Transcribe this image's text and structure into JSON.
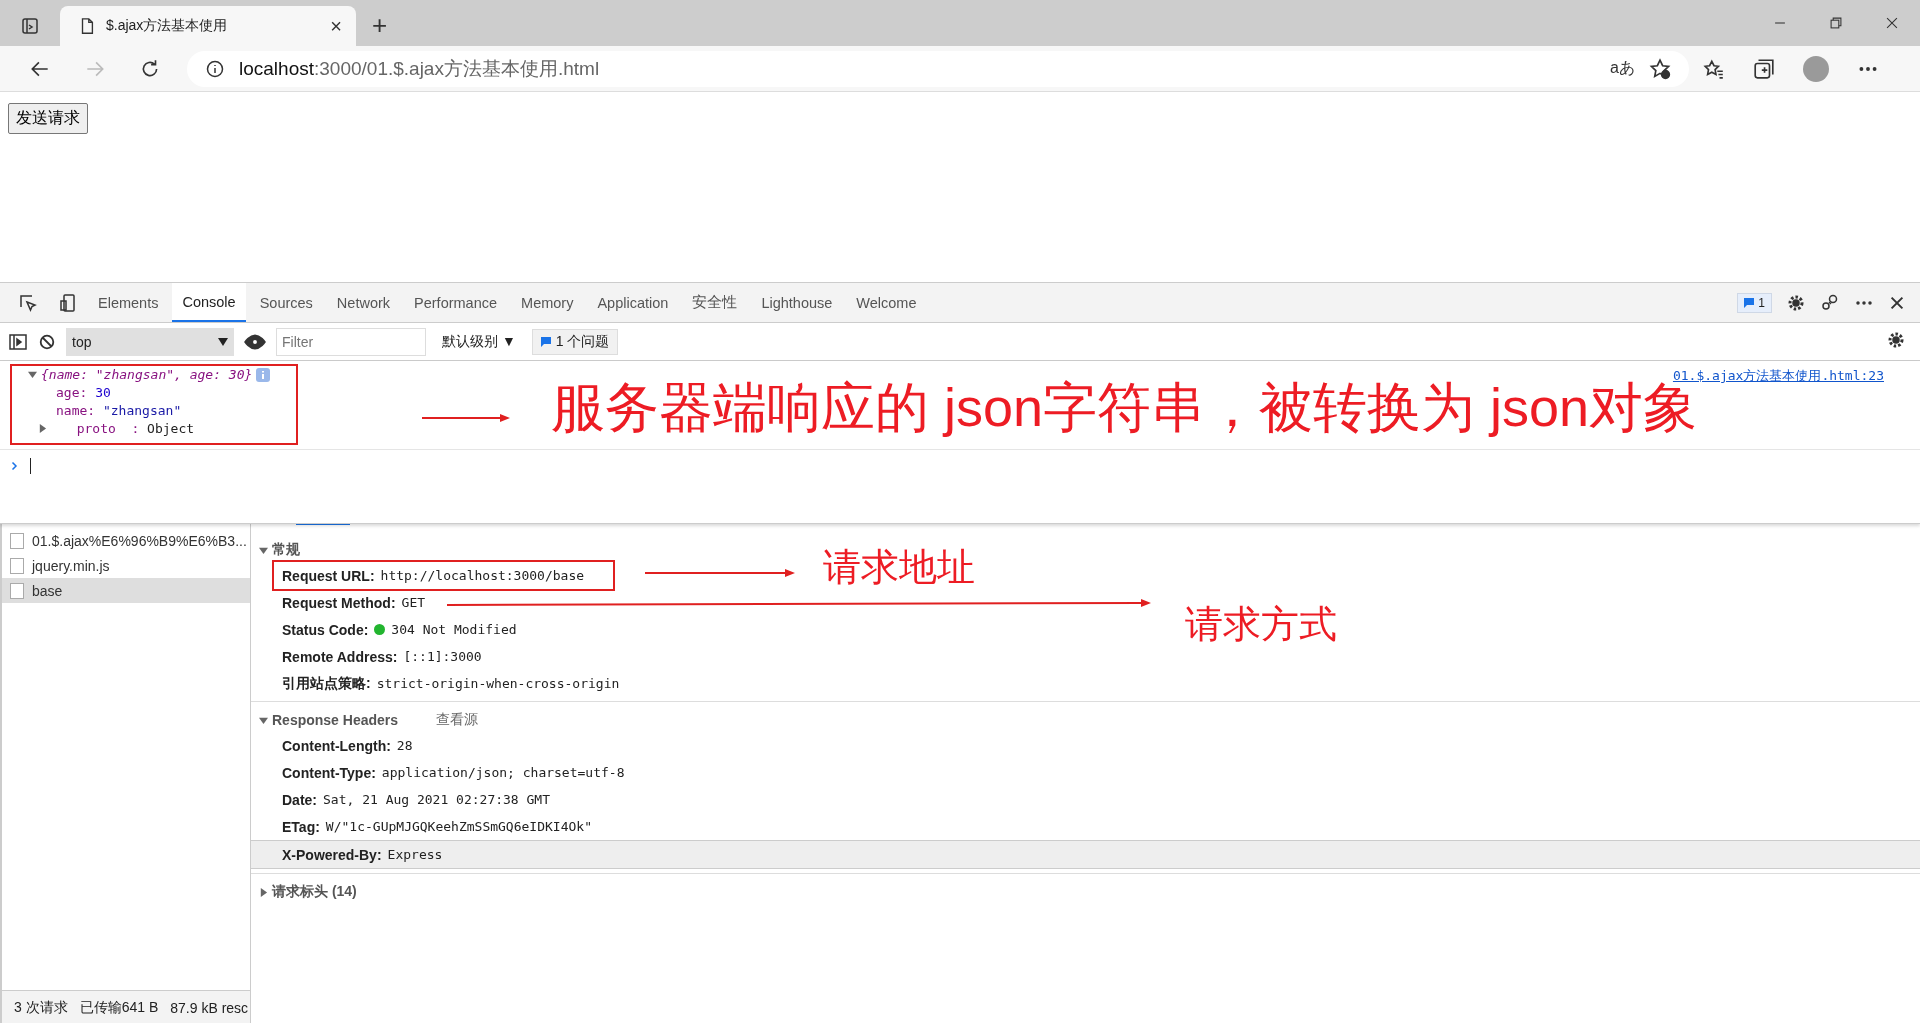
{
  "browser": {
    "tab": {
      "title": "$.ajax方法基本使用",
      "close": "×"
    },
    "new_tab": "+",
    "address": {
      "host": "localhost",
      "path": ":3000/01.$.ajax方法基本使用.html"
    },
    "read_aloud": "aあ"
  },
  "page": {
    "button": "发送请求"
  },
  "devtools": {
    "tabs": [
      {
        "label": "Elements",
        "selected": false
      },
      {
        "label": "Console",
        "selected": true
      },
      {
        "label": "Sources",
        "selected": false
      },
      {
        "label": "Network",
        "selected": false
      },
      {
        "label": "Performance",
        "selected": false
      },
      {
        "label": "Memory",
        "selected": false
      },
      {
        "label": "Application",
        "selected": false
      },
      {
        "label": "安全性",
        "selected": false
      },
      {
        "label": "Lighthouse",
        "selected": false
      },
      {
        "label": "Welcome",
        "selected": false
      }
    ],
    "issues_badge": "1",
    "console": {
      "context": "top",
      "filter_placeholder": "Filter",
      "levels": "默认级别 ▼",
      "issues": "1 个问题",
      "message": {
        "summary": "{name: \"zhangsan\", age: 30}",
        "expanded": true,
        "source": "01.$.ajax方法基本使用.html:23",
        "properties": [
          {
            "key": "age:",
            "value": "30",
            "kind": "number"
          },
          {
            "key": "name:",
            "value": "\"zhangsan\"",
            "kind": "string"
          },
          {
            "key": "proto  :",
            "value": "Object",
            "kind": "prototype"
          }
        ]
      }
    },
    "network": {
      "requests": [
        {
          "name": "01.$.ajax%E6%96%B9%E6%B3...",
          "selected": false
        },
        {
          "name": "jquery.min.js",
          "selected": false
        },
        {
          "name": "base",
          "selected": true
        }
      ],
      "general": {
        "title": "常规",
        "expanded": true,
        "rows": [
          {
            "key": "Request URL:",
            "value": "http://localhost:3000/base",
            "kind": "text"
          },
          {
            "key": "Request Method:",
            "value": "GET",
            "kind": "text"
          },
          {
            "key": "Status Code:",
            "value": "304 Not Modified",
            "kind": "status"
          },
          {
            "key": "Remote Address:",
            "value": "[::1]:3000",
            "kind": "text"
          },
          {
            "key": "引用站点策略:",
            "value": "strict-origin-when-cross-origin",
            "kind": "text"
          }
        ]
      },
      "response_headers": {
        "title": "Response Headers",
        "expanded": true,
        "view_source": "查看源",
        "rows": [
          {
            "key": "Content-Length:",
            "value": "28",
            "highlighted": false
          },
          {
            "key": "Content-Type:",
            "value": "application/json; charset=utf-8",
            "highlighted": false
          },
          {
            "key": "Date:",
            "value": "Sat, 21 Aug 2021 02:27:38 GMT",
            "highlighted": false
          },
          {
            "key": "ETag:",
            "value": "W/\"1c-GUpMJGQKeehZmSSmGQ6eIDKI4Ok\"",
            "highlighted": false
          },
          {
            "key": "X-Powered-By:",
            "value": "Express",
            "highlighted": true
          }
        ]
      },
      "request_headers": {
        "title": "请求标头 (14)",
        "expanded": false
      },
      "status_bar": [
        "3 次请求",
        "已传输641 B",
        "87.9 kB resc"
      ]
    }
  },
  "annotations": [
    {
      "text": "服务器端响应的 json字符串，被转换为 json对象",
      "kind": "large"
    },
    {
      "text": "请求地址",
      "kind": "medium"
    },
    {
      "text": "请求方式",
      "kind": "medium"
    }
  ]
}
